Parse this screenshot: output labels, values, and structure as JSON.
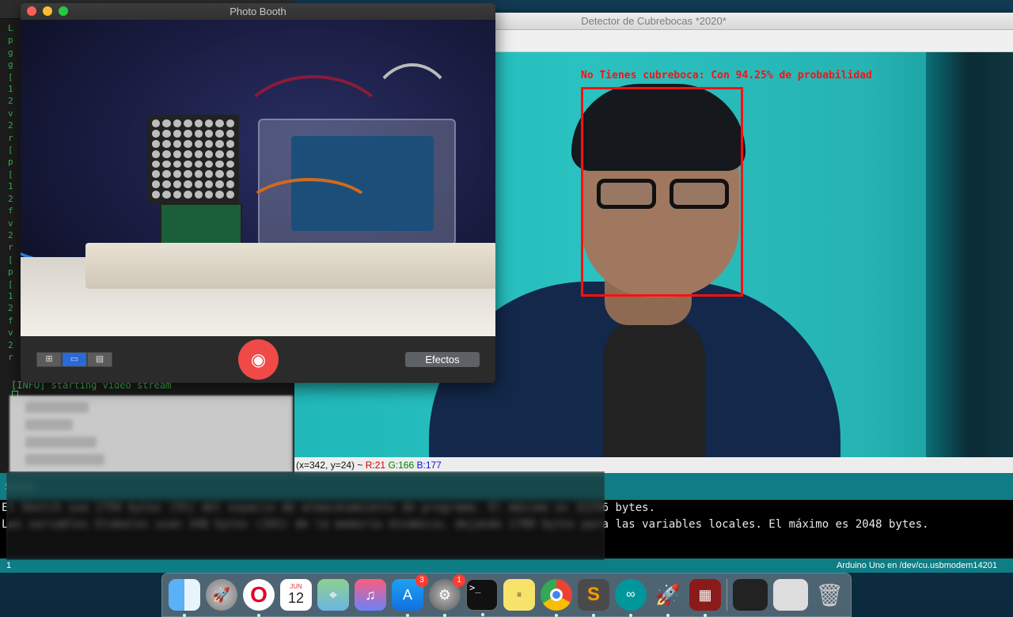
{
  "photo_booth": {
    "title": "Photo Booth",
    "layout_buttons": [
      "grid",
      "single",
      "filmstrip"
    ],
    "effects_label": "Efectos"
  },
  "detector": {
    "title": "Detector de Cubrebocas *2020*",
    "detection_label": "No Tienes cubreboca: Con 94.25% de probabilidad",
    "status": {
      "coords": "(x=342, y=24) ~ ",
      "r": "R:21",
      "g": "G:166",
      "b": "B:177"
    }
  },
  "terminal": {
    "info_line": "[INFO] starting video stream"
  },
  "console": {
    "line1": "El Sketch usa 1794 bytes (5%) del espacio de almacenamiento de programa. El máximo es 32256 bytes.",
    "line2": "Las variables Globales usan 348 bytes (16%) de la memoria dinámica, dejando 1700 bytes para las variables locales. El máximo es 2048 bytes.",
    "line_number": "1",
    "board": "Arduino Uno en /dev/cu.usbmodem14201"
  },
  "dock": {
    "calendar_month": "JUN",
    "calendar_day": "12",
    "appstore_badge": "3",
    "prefs_badge": "1"
  }
}
